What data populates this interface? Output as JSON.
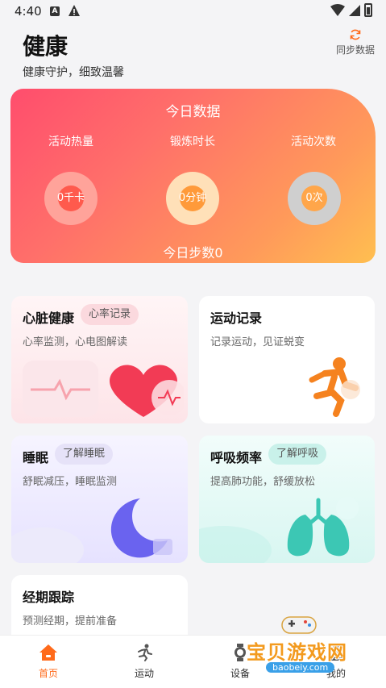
{
  "status_bar": {
    "time": "4:40",
    "a_icon": "A"
  },
  "header": {
    "title": "健康",
    "subtitle": "健康守护，细致温馨",
    "sync_label": "同步数据"
  },
  "today": {
    "title": "今日数据",
    "metrics": [
      {
        "label": "活动热量",
        "value": "0千卡",
        "ring_color": "#ffa39a",
        "inner_color": "#ff5a4d"
      },
      {
        "label": "锻炼时长",
        "value": "0分钟",
        "ring_color": "#ffe0b8",
        "inner_color": "#ff9a3a"
      },
      {
        "label": "活动次数",
        "value": "0次",
        "ring_color": "#cfcfcf",
        "inner_color": "#ffa64a"
      }
    ],
    "steps": "今日步数0"
  },
  "cards": {
    "heart": {
      "title": "心脏健康",
      "tag": "心率记录",
      "desc": "心率监测，心电图解读"
    },
    "sport": {
      "title": "运动记录",
      "desc": "记录运动，见证蜕变"
    },
    "sleep": {
      "title": "睡眠",
      "tag": "了解睡眠",
      "desc": "舒眠减压，睡眠监测"
    },
    "breath": {
      "title": "呼吸频率",
      "tag": "了解呼吸",
      "desc": "提高肺功能，舒缓放松"
    },
    "period": {
      "title": "经期跟踪",
      "desc": "预测经期，提前准备"
    }
  },
  "nav": [
    {
      "label": "首页",
      "icon": "home-icon",
      "active": true
    },
    {
      "label": "运动",
      "icon": "running-icon",
      "active": false
    },
    {
      "label": "设备",
      "icon": "watch-icon",
      "active": false
    },
    {
      "label": "我的",
      "icon": "user-icon",
      "active": false
    }
  ],
  "watermark": {
    "text": "宝贝游戏网",
    "url": "baobeiy.com"
  },
  "colors": {
    "accent": "#ff6a1a"
  }
}
